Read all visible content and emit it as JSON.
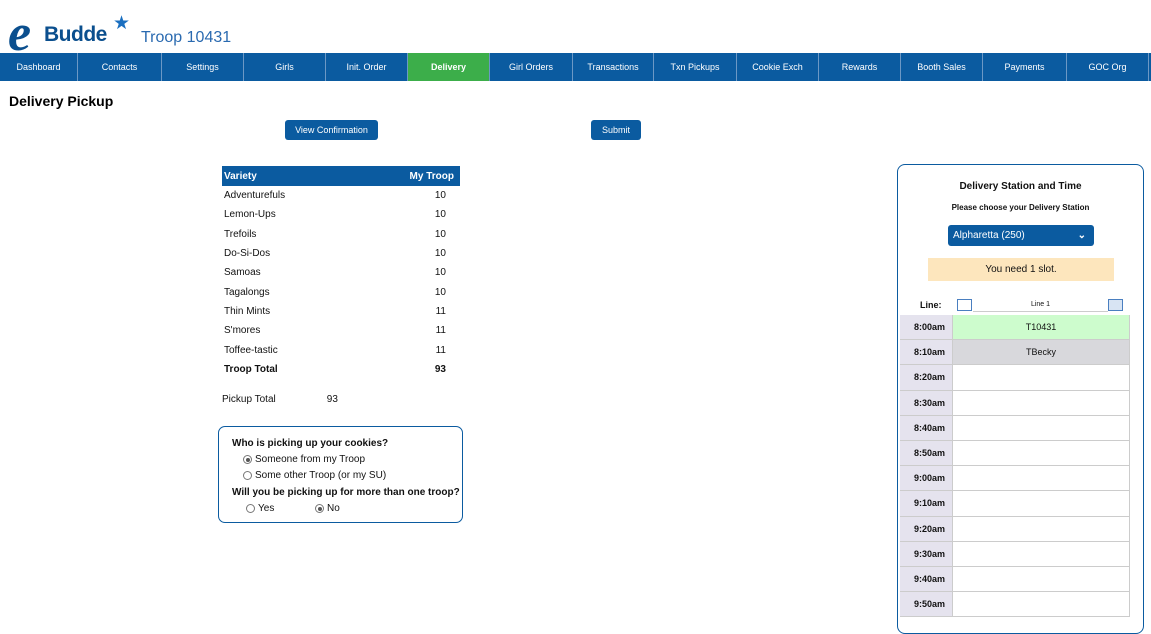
{
  "header": {
    "logo_e": "e",
    "logo_text": "Budde",
    "logo_star": "★",
    "troop": "Troop 10431"
  },
  "nav": [
    {
      "label": "Dashboard",
      "active": false
    },
    {
      "label": "Contacts",
      "active": false
    },
    {
      "label": "Settings",
      "active": false
    },
    {
      "label": "Girls",
      "active": false
    },
    {
      "label": "Init. Order",
      "active": false
    },
    {
      "label": "Delivery",
      "active": true
    },
    {
      "label": "Girl Orders",
      "active": false
    },
    {
      "label": "Transactions",
      "active": false
    },
    {
      "label": "Txn Pickups",
      "active": false
    },
    {
      "label": "Cookie Exch",
      "active": false
    },
    {
      "label": "Rewards",
      "active": false
    },
    {
      "label": "Booth Sales",
      "active": false
    },
    {
      "label": "Payments",
      "active": false
    },
    {
      "label": "GOC Org",
      "active": false
    }
  ],
  "page": {
    "title": "Delivery Pickup",
    "view_confirmation": "View Confirmation",
    "submit": "Submit"
  },
  "variety_table": {
    "headers": [
      "Variety",
      "My Troop"
    ],
    "rows": [
      {
        "name": "Adventurefuls",
        "qty": "10"
      },
      {
        "name": "Lemon-Ups",
        "qty": "10"
      },
      {
        "name": "Trefoils",
        "qty": "10"
      },
      {
        "name": "Do-Si-Dos",
        "qty": "10"
      },
      {
        "name": "Samoas",
        "qty": "10"
      },
      {
        "name": "Tagalongs",
        "qty": "10"
      },
      {
        "name": "Thin Mints",
        "qty": "11"
      },
      {
        "name": "S'mores",
        "qty": "11"
      },
      {
        "name": "Toffee-tastic",
        "qty": "11"
      }
    ],
    "total_label": "Troop Total",
    "total": "93",
    "pickup_label": "Pickup Total",
    "pickup_total": "93"
  },
  "pickup": {
    "question1": "Who is picking up your cookies?",
    "opt_own": "Someone from my Troop",
    "opt_other": "Some other Troop (or my SU)",
    "question2": "Will you be picking up for more than one troop?",
    "opt_yes": "Yes",
    "opt_no": "No",
    "selected_who": "Someone from my Troop",
    "selected_multi": "No"
  },
  "delivery": {
    "title": "Delivery Station and Time",
    "subtitle": "Please choose your Delivery Station",
    "station": "Alpharetta (250)",
    "need_slot": "You need 1 slot.",
    "line_label": "Line:",
    "line_name": "Line 1",
    "slots": [
      {
        "time": "8:00am",
        "value": "T10431",
        "status": "mine"
      },
      {
        "time": "8:10am",
        "value": "TBecky",
        "status": "taken"
      },
      {
        "time": "8:20am",
        "value": "",
        "status": "open"
      },
      {
        "time": "8:30am",
        "value": "",
        "status": "open"
      },
      {
        "time": "8:40am",
        "value": "",
        "status": "open"
      },
      {
        "time": "8:50am",
        "value": "",
        "status": "open"
      },
      {
        "time": "9:00am",
        "value": "",
        "status": "open"
      },
      {
        "time": "9:10am",
        "value": "",
        "status": "open"
      },
      {
        "time": "9:20am",
        "value": "",
        "status": "open"
      },
      {
        "time": "9:30am",
        "value": "",
        "status": "open"
      },
      {
        "time": "9:40am",
        "value": "",
        "status": "open"
      },
      {
        "time": "9:50am",
        "value": "",
        "status": "open"
      }
    ]
  },
  "colors": {
    "brand_blue": "#0b5ba0",
    "active_green": "#3cae4a",
    "own_slot": "#cdfccd",
    "notice": "#fde6bd"
  }
}
